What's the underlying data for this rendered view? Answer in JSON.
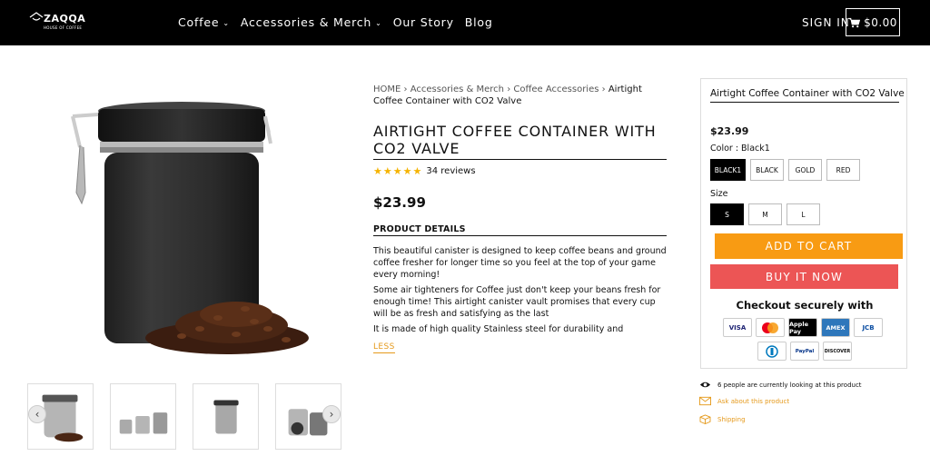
{
  "header": {
    "logo": {
      "brand": "ZAQQA",
      "tagline": "HOUSE OF COFFEE"
    },
    "nav": [
      {
        "label": "Coffee",
        "dropdown": true
      },
      {
        "label": "Accessories & Merch",
        "dropdown": true
      },
      {
        "label": "Our Story",
        "dropdown": false
      },
      {
        "label": "Blog",
        "dropdown": false
      }
    ],
    "sign_in": "SIGN IN",
    "cart_total": "$0.00"
  },
  "breadcrumb": {
    "home": "HOME",
    "sep": "›",
    "c1": "Accessories & Merch",
    "c2": "Coffee Accessories",
    "current": "Airtight Coffee Container with CO2 Valve"
  },
  "product": {
    "title": "AIRTIGHT COFFEE CONTAINER WITH CO2 VALVE",
    "rating_stars": 5,
    "reviews": "34 reviews",
    "price": "$23.99",
    "details_heading": "PRODUCT DETAILS",
    "description": [
      "This beautiful canister is designed to keep coffee beans and ground coffee fresher for longer time so you feel at the top of your game every morning!",
      "Some air tighteners for Coffee just don't keep your beans fresh for enough time! This airtight canister vault promises that every cup will be as fresh and satisfying as the last",
      "It is made of high quality Stainless steel for durability and resistance to"
    ],
    "less_label": "LESS"
  },
  "panel": {
    "title": "Airtight Coffee Container with CO2 Valve",
    "price": "$23.99",
    "color_label": "Color : Black1",
    "colors": [
      "BLACK1",
      "BLACK",
      "GOLD",
      "RED"
    ],
    "selected_color": "BLACK1",
    "size_label": "Size",
    "sizes": [
      "S",
      "M",
      "L"
    ],
    "selected_size": "S",
    "add_to_cart": "ADD TO CART",
    "buy_now": "BUY IT NOW",
    "checkout_text": "Checkout securely with",
    "payment_row1": [
      "VISA",
      "mastercard",
      "Apple Pay",
      "AMEX",
      "JCB"
    ],
    "payment_row2": [
      "Diners Club",
      "PayPal",
      "DISCOVER"
    ]
  },
  "info": {
    "viewers": "6 people are currently looking at this product",
    "ask": "Ask about this product",
    "shipping": "Shipping"
  },
  "colors": {
    "header_bg": "#000000",
    "cart_button": "#f89b13",
    "buy_button": "#ec5555",
    "accent_link": "#e59a1c",
    "star": "#f5b301"
  }
}
